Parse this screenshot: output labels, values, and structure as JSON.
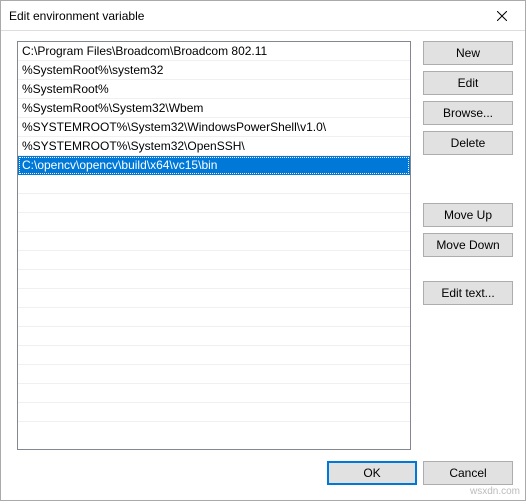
{
  "window": {
    "title": "Edit environment variable"
  },
  "list": {
    "items": [
      "C:\\Program Files\\Broadcom\\Broadcom 802.11",
      "%SystemRoot%\\system32",
      "%SystemRoot%",
      "%SystemRoot%\\System32\\Wbem",
      "%SYSTEMROOT%\\System32\\WindowsPowerShell\\v1.0\\",
      "%SYSTEMROOT%\\System32\\OpenSSH\\",
      "C:\\opencv\\opencv\\build\\x64\\vc15\\bin"
    ],
    "selectedIndex": 6
  },
  "buttons": {
    "new": "New",
    "edit": "Edit",
    "browse": "Browse...",
    "delete": "Delete",
    "moveUp": "Move Up",
    "moveDown": "Move Down",
    "editText": "Edit text...",
    "ok": "OK",
    "cancel": "Cancel"
  },
  "watermark": "wsxdn.com"
}
